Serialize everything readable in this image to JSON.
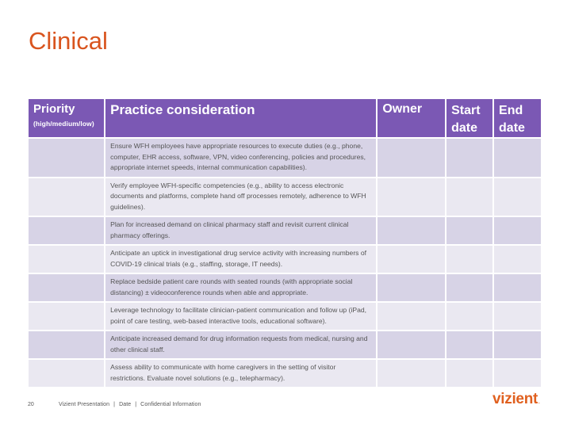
{
  "slide": {
    "title": "Clinical",
    "page_number": "20",
    "footer": {
      "presentation": "Vizient Presentation",
      "separator": "|",
      "date": "Date",
      "confidential": "Confidential Information"
    },
    "logo": {
      "text": "vizient",
      "mark": "."
    },
    "colors": {
      "title": "#d9541e",
      "header_bg": "#7b58b4",
      "row_odd": "#d7d3e6",
      "row_even": "#eae8f1",
      "logo": "#e0601f"
    }
  },
  "table": {
    "headers": {
      "priority": "Priority",
      "priority_sub": "(high/medium/low)",
      "practice": "Practice consideration",
      "owner": "Owner",
      "start": "Start date",
      "end": "End date"
    },
    "rows": [
      {
        "priority": "",
        "practice": "Ensure WFH employees have appropriate resources to execute duties (e.g., phone, computer, EHR access, software, VPN, video conferencing, policies and procedures, appropriate internet speeds, internal communication capabilities).",
        "owner": "",
        "start": "",
        "end": ""
      },
      {
        "priority": "",
        "practice": "Verify employee WFH-specific competencies (e.g., ability to access electronic documents and platforms, complete hand off processes remotely, adherence to WFH guidelines).",
        "owner": "",
        "start": "",
        "end": ""
      },
      {
        "priority": "",
        "practice": "Plan for increased demand on clinical pharmacy staff and revisit current clinical pharmacy offerings.",
        "owner": "",
        "start": "",
        "end": ""
      },
      {
        "priority": "",
        "practice": "Anticipate an uptick in investigational drug service activity with increasing numbers of COVID-19 clinical trials (e.g., staffing, storage, IT needs).",
        "owner": "",
        "start": "",
        "end": ""
      },
      {
        "priority": "",
        "practice": "Replace bedside patient care rounds with seated rounds (with appropriate social distancing) ± videoconference rounds when able and appropriate.",
        "owner": "",
        "start": "",
        "end": ""
      },
      {
        "priority": "",
        "practice": "Leverage technology to facilitate clinician-patient communication and follow up (iPad, point of care testing, web-based interactive tools, educational software).",
        "owner": "",
        "start": "",
        "end": ""
      },
      {
        "priority": "",
        "practice": "Anticipate increased demand for drug information requests from medical, nursing and other clinical staff.",
        "owner": "",
        "start": "",
        "end": ""
      },
      {
        "priority": "",
        "practice": "Assess ability to communicate with home caregivers in the setting of visitor restrictions. Evaluate novel solutions (e.g., telepharmacy).",
        "owner": "",
        "start": "",
        "end": ""
      }
    ]
  }
}
